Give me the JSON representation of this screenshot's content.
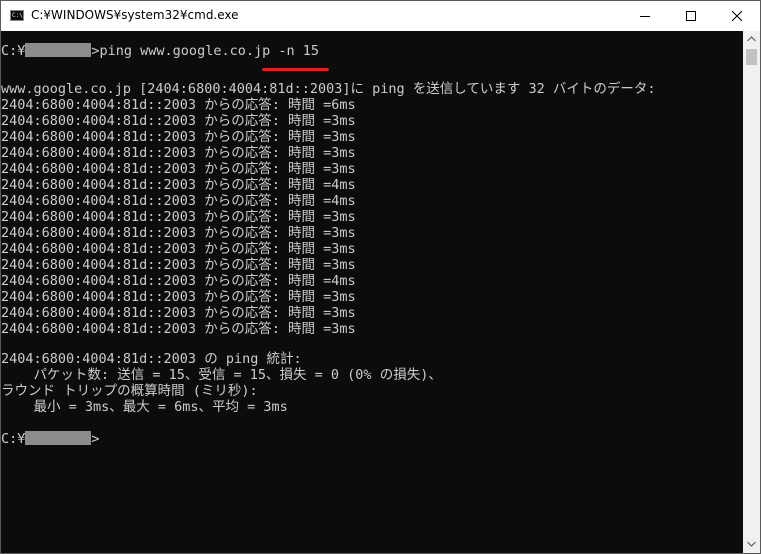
{
  "window": {
    "title": "C:¥WINDOWS¥system32¥cmd.exe",
    "icon": "cmd-icon",
    "icon_text": "C:\\"
  },
  "console": {
    "prompt_prefix": "C:¥",
    "prompt_suffix": ">",
    "command_text": "ping www.google.co.jp -n 15",
    "header_line": "www.google.co.jp [2404:6800:4004:81d::2003]に ping を送信しています 32 バイトのデータ:",
    "replies": [
      "2404:6800:4004:81d::2003 からの応答: 時間 =6ms",
      "2404:6800:4004:81d::2003 からの応答: 時間 =3ms",
      "2404:6800:4004:81d::2003 からの応答: 時間 =3ms",
      "2404:6800:4004:81d::2003 からの応答: 時間 =3ms",
      "2404:6800:4004:81d::2003 からの応答: 時間 =3ms",
      "2404:6800:4004:81d::2003 からの応答: 時間 =4ms",
      "2404:6800:4004:81d::2003 からの応答: 時間 =4ms",
      "2404:6800:4004:81d::2003 からの応答: 時間 =3ms",
      "2404:6800:4004:81d::2003 からの応答: 時間 =3ms",
      "2404:6800:4004:81d::2003 からの応答: 時間 =3ms",
      "2404:6800:4004:81d::2003 からの応答: 時間 =3ms",
      "2404:6800:4004:81d::2003 からの応答: 時間 =4ms",
      "2404:6800:4004:81d::2003 からの応答: 時間 =3ms",
      "2404:6800:4004:81d::2003 からの応答: 時間 =3ms",
      "2404:6800:4004:81d::2003 からの応答: 時間 =3ms"
    ],
    "stats_header": "2404:6800:4004:81d::2003 の ping 統計:",
    "stats_packets": "    パケット数: 送信 = 15、受信 = 15、損失 = 0 (0% の損失)、",
    "rtt_header": "ラウンド トリップの概算時間 (ミリ秒):",
    "rtt_values": "    最小 = 3ms、最大 = 6ms、平均 = 3ms"
  },
  "annotation": {
    "underline_color": "#e0221b"
  },
  "colors": {
    "console_bg": "#0c0c0c",
    "console_text": "#cccccc",
    "redaction": "#8c8c8c"
  }
}
